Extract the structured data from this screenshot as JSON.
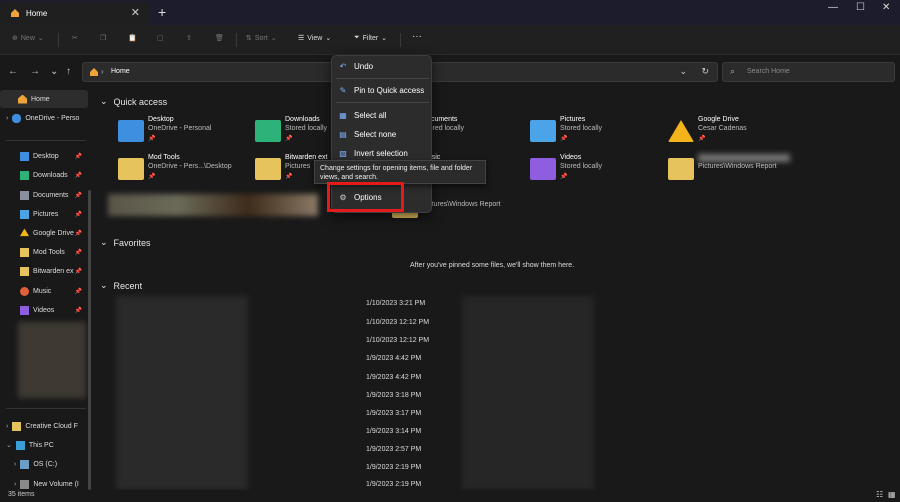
{
  "window": {
    "tab_title": "Home",
    "new_tab": "+",
    "minimize": "—",
    "maximize": "☐",
    "close": "✕"
  },
  "toolbar": {
    "new": "New",
    "sort": "Sort",
    "view": "View",
    "filter": "Filter",
    "more": "···"
  },
  "address": {
    "path": "Home",
    "search_placeholder": "Search Home"
  },
  "sidebar": {
    "home": "Home",
    "onedrive": "OneDrive - Perso",
    "pinned": [
      {
        "label": "Desktop",
        "color": "#3f8fe0"
      },
      {
        "label": "Downloads",
        "color": "#2db37a"
      },
      {
        "label": "Documents",
        "color": "#8a8fa0"
      },
      {
        "label": "Pictures",
        "color": "#4ba3e8"
      },
      {
        "label": "Google Drive",
        "color": "#f2b41a"
      },
      {
        "label": "Mod Tools",
        "color": "#e6c35c"
      },
      {
        "label": "Bitwarden ex",
        "color": "#e6c35c"
      },
      {
        "label": "Music",
        "color": "#e0603c"
      },
      {
        "label": "Videos",
        "color": "#8e5de0"
      }
    ],
    "creative_cloud": "Creative Cloud F",
    "this_pc": "This PC",
    "os_c": "OS (C:)",
    "new_volume": "New Volume (I"
  },
  "main": {
    "quick_access": "Quick access",
    "favorites": "Favorites",
    "favorites_empty": "After you've pinned some files, we'll show them here.",
    "recent": "Recent",
    "tiles": [
      {
        "name": "Desktop",
        "sub": "OneDrive - Personal"
      },
      {
        "name": "Downloads",
        "sub": "Stored locally"
      },
      {
        "name": "Documents",
        "sub": "Stored locally"
      },
      {
        "name": "Pictures",
        "sub": "Stored locally"
      },
      {
        "name": "Google Drive",
        "sub": "Cesar Cadenas"
      },
      {
        "name": "Mod Tools",
        "sub": "OneDrive - Pers...\\Desktop"
      },
      {
        "name": "Bitwarden ext",
        "sub": "Pictures"
      },
      {
        "name": "Music",
        "sub": ""
      },
      {
        "name": "Videos",
        "sub": "Stored locally"
      },
      {
        "name": "",
        "sub": "Pictures\\Windows Report"
      },
      {
        "name": "",
        "sub": "Pictures\\Windows Report"
      }
    ],
    "recent_dates": [
      "1/10/2023 3:21 PM",
      "1/10/2023 12:12 PM",
      "1/10/2023 12:12 PM",
      "1/9/2023 4:42 PM",
      "1/9/2023 4:42 PM",
      "1/9/2023 3:18 PM",
      "1/9/2023 3:17 PM",
      "1/9/2023 3:14 PM",
      "1/9/2023 2:57 PM",
      "1/9/2023 2:19 PM",
      "1/9/2023 2:19 PM"
    ]
  },
  "menu": {
    "undo": "Undo",
    "pin": "Pin to Quick access",
    "select_all": "Select all",
    "select_none": "Select none",
    "invert": "Invert selection",
    "options": "Options",
    "tooltip": "Change settings for opening items, file and folder views, and search."
  },
  "status": {
    "count": "35 items"
  },
  "colors": {
    "highlight": "#e51a1a",
    "accent": "#7fb3ff"
  }
}
